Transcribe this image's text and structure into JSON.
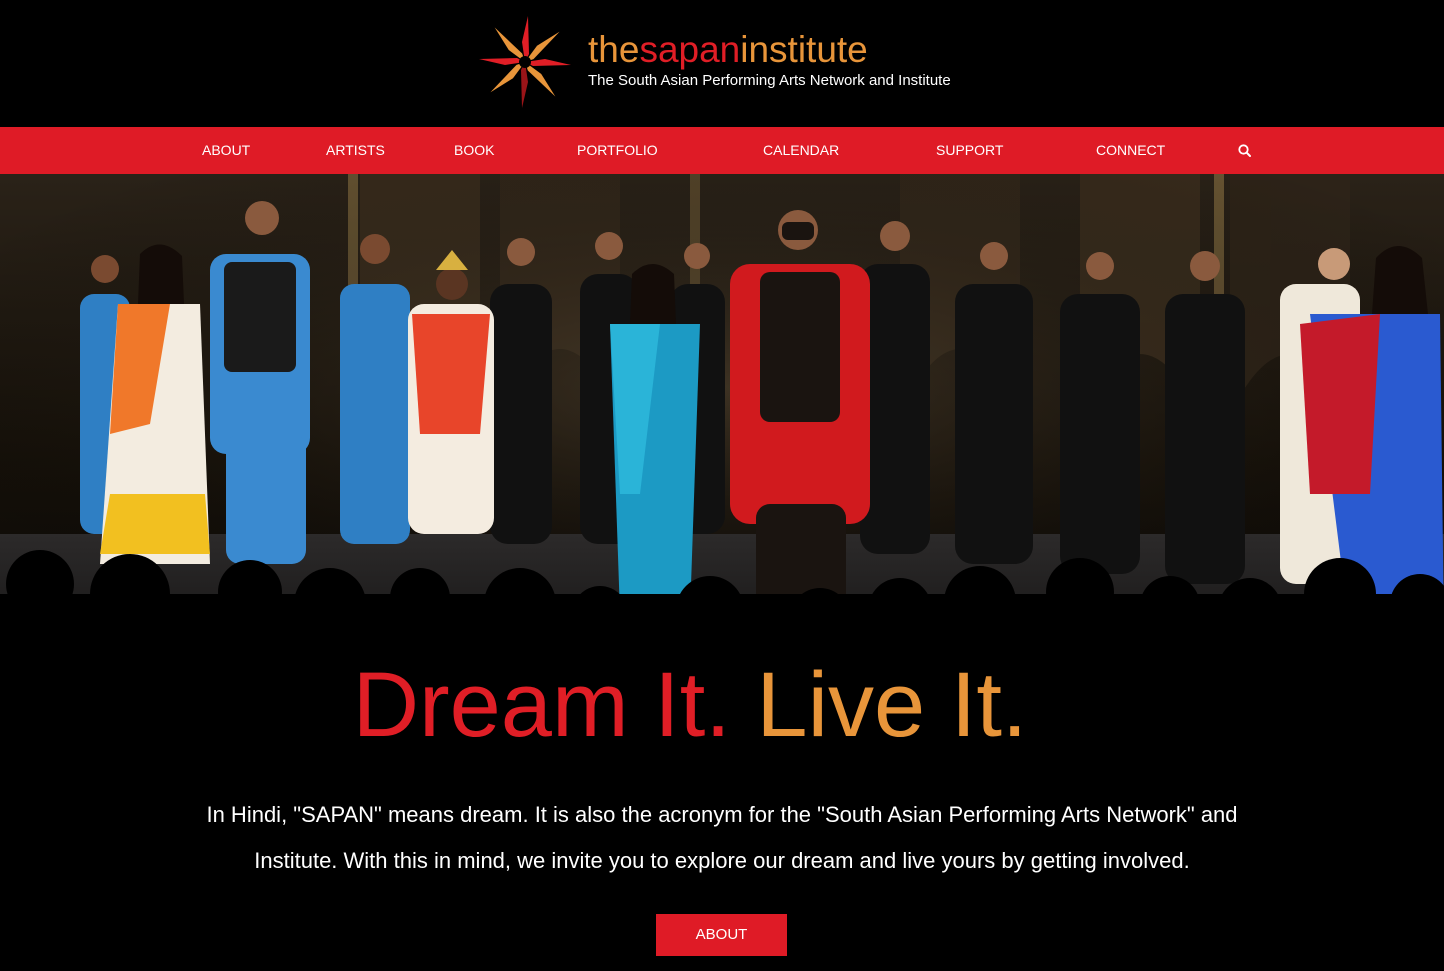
{
  "brand": {
    "wordmark_part1": "the",
    "wordmark_part2": "sapan",
    "wordmark_part3": "institute",
    "tagline": "The South Asian Performing Arts Network and Institute",
    "logo_icon": "starburst-logo",
    "colors": {
      "red": "#df1b26",
      "orange": "#e8953a",
      "dark_red": "#9a1418"
    }
  },
  "nav": {
    "items": [
      {
        "label": "ABOUT"
      },
      {
        "label": "ARTISTS"
      },
      {
        "label": "BOOK"
      },
      {
        "label": "PORTFOLIO"
      },
      {
        "label": "CALENDAR"
      },
      {
        "label": "SUPPORT"
      },
      {
        "label": "CONNECT"
      }
    ],
    "search_icon": "search-icon",
    "background": "#df1b26"
  },
  "hero": {
    "image_subject": "stage-curtain-call-photo"
  },
  "headline": {
    "part1": "Dream It.",
    "part2": "Live It."
  },
  "intro": {
    "text": "In Hindi, \"SAPAN\" means dream. It is also the acronym for the \"South Asian Performing Arts Network\" and Institute. With this in mind, we invite you to explore our dream and live yours by getting involved."
  },
  "cta": {
    "label": "ABOUT"
  }
}
